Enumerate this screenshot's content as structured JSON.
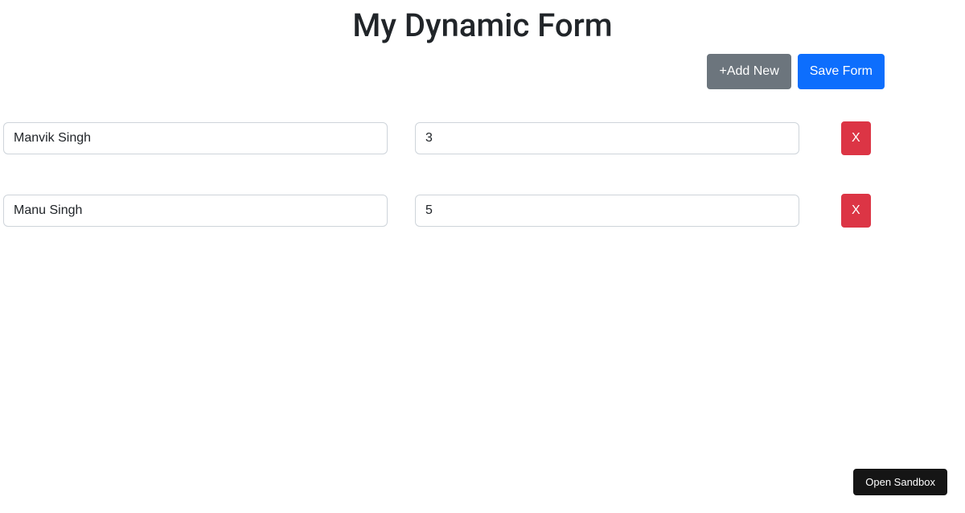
{
  "header": {
    "title": "My Dynamic Form"
  },
  "toolbar": {
    "add_new_label": "+Add New",
    "save_form_label": "Save Form"
  },
  "rows": [
    {
      "name": "Manvik Singh",
      "value": "3",
      "remove_label": "X"
    },
    {
      "name": "Manu Singh",
      "value": "5",
      "remove_label": "X"
    }
  ],
  "footer": {
    "open_sandbox_label": "Open Sandbox"
  }
}
